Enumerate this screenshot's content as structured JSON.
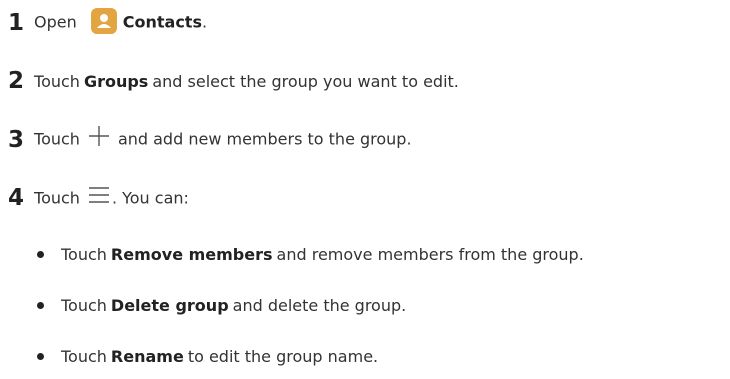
{
  "steps": [
    {
      "number": "1",
      "prefix": "Open",
      "bold": "Contacts",
      "suffix": ".",
      "icon": "contacts-app-icon"
    },
    {
      "number": "2",
      "prefix": "Touch",
      "bold": "Groups",
      "suffix": "and select the group you want to edit."
    },
    {
      "number": "3",
      "prefix": "Touch",
      "suffix": "and add new members to the group.",
      "icon": "plus-icon"
    },
    {
      "number": "4",
      "prefix": "Touch",
      "suffix": ". You can:",
      "icon": "menu-icon"
    }
  ],
  "options": [
    {
      "prefix": "Touch",
      "bold": "Remove members",
      "suffix": "and remove members from the group."
    },
    {
      "prefix": "Touch",
      "bold": "Delete group",
      "suffix": "and delete the group."
    },
    {
      "prefix": "Touch",
      "bold": "Rename",
      "suffix": "to edit the group name."
    }
  ],
  "colors": {
    "contacts_icon_bg": "#e3a541",
    "text": "#333333"
  }
}
